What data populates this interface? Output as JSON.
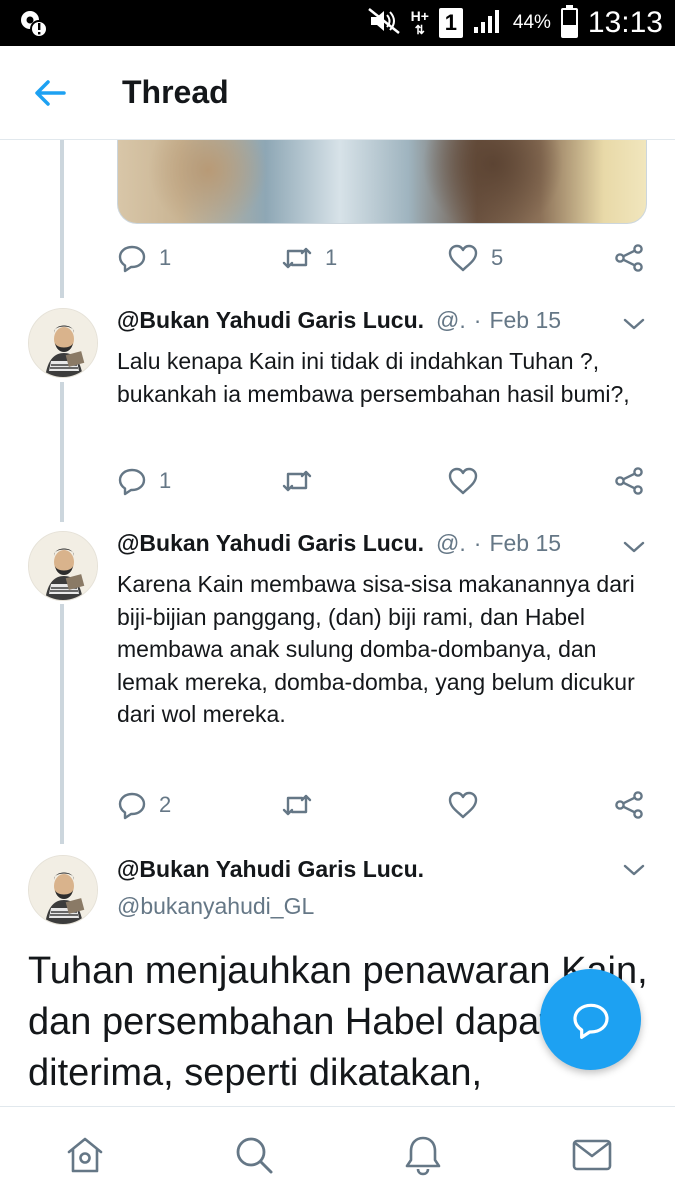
{
  "status_bar": {
    "left_icon": "location-alert-icon",
    "hplus": "H+",
    "sim": "1",
    "battery": "44%",
    "battery_level": 0.44,
    "time": "13:13"
  },
  "header": {
    "back_icon": "back-arrow-icon",
    "title": "Thread"
  },
  "prev_tweet_actions": {
    "replies": "1",
    "retweets": "1",
    "likes": "5"
  },
  "tweets": [
    {
      "name": "@Bukan Yahudi Garis Lucu.",
      "handle": "@.",
      "date": "Feb 15",
      "text": "Lalu kenapa Kain ini tidak di indahkan Tuhan ?, bukankah ia membawa persembahan hasil bumi?,",
      "replies": "1",
      "retweets": "",
      "likes": ""
    },
    {
      "name": "@Bukan Yahudi Garis Lucu.",
      "handle": "@.",
      "date": "Feb 15",
      "text": "Karena Kain membawa sisa-sisa makanannya dari biji-bijian panggang, (dan) biji rami, dan Habel membawa anak sulung domba-dombanya, dan lemak mereka, domba-domba, yang belum dicukur dari wol mereka.",
      "replies": "2",
      "retweets": "",
      "likes": ""
    }
  ],
  "focused_tweet": {
    "name": "@Bukan Yahudi Garis Lucu.",
    "handle": "@bukanyahudi_GL",
    "text": "Tuhan menjauhkan penawaran Kain, dan persembahan Habel dapat diterima, seperti dikatakan,"
  },
  "bottom_nav": [
    "home-icon",
    "search-icon",
    "notifications-icon",
    "messages-icon"
  ],
  "colors": {
    "accent": "#1da1f2",
    "text": "#14171a",
    "muted": "#657786",
    "divider": "#e1e8ed"
  }
}
